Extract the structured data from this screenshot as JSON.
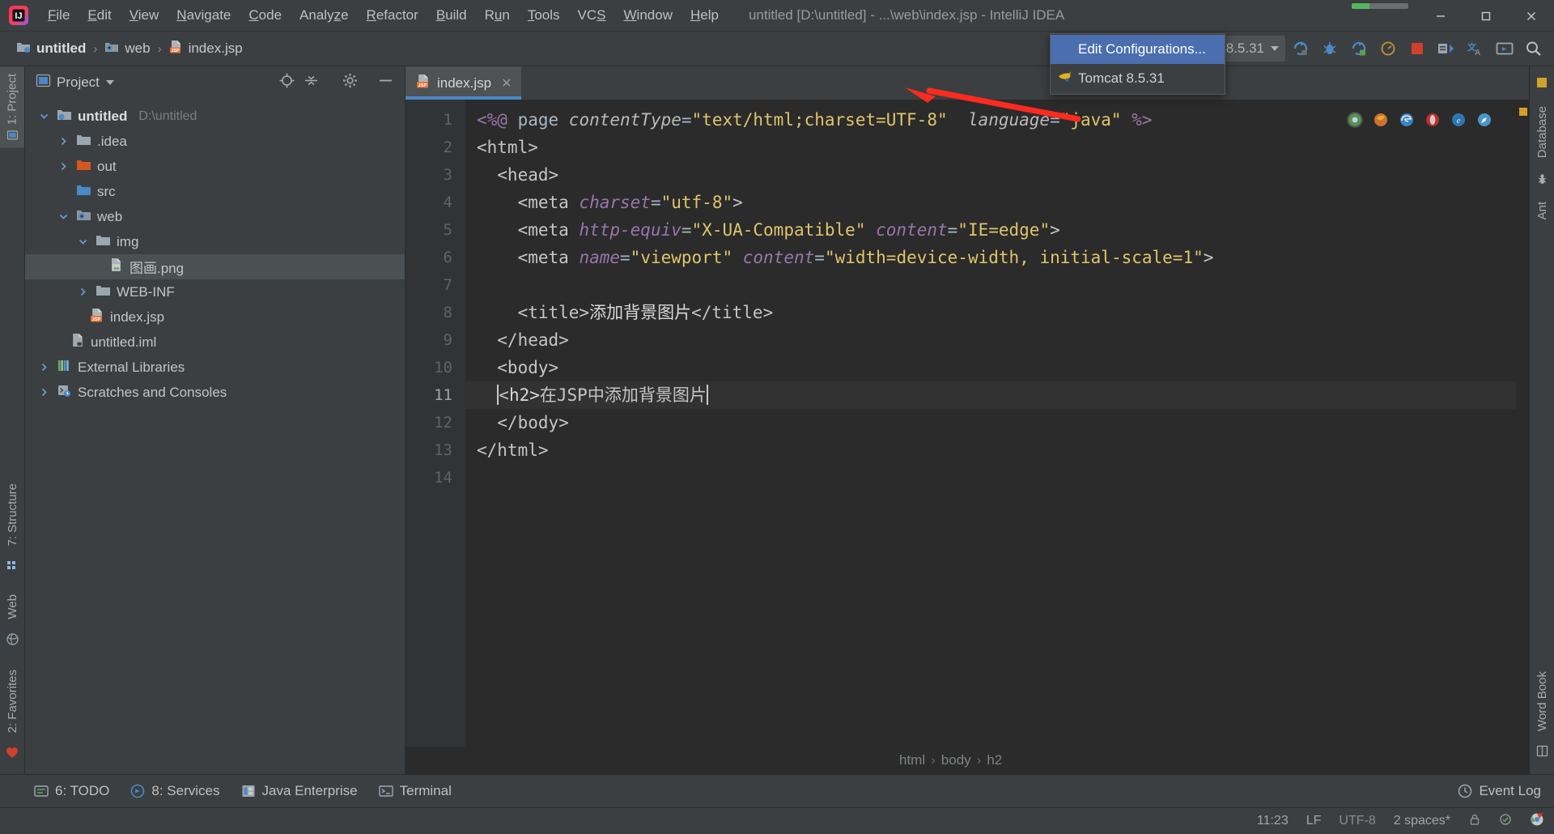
{
  "window": {
    "title": "untitled [D:\\untitled] - ...\\web\\index.jsp - IntelliJ IDEA",
    "progress_percent": 32,
    "minimize_label": "—",
    "maximize_label": "❐",
    "close_label": "✕"
  },
  "menubar": {
    "items": [
      {
        "label": "File",
        "mnemonic": "F"
      },
      {
        "label": "Edit",
        "mnemonic": "E"
      },
      {
        "label": "View",
        "mnemonic": "V"
      },
      {
        "label": "Navigate",
        "mnemonic": "N"
      },
      {
        "label": "Code",
        "mnemonic": "C"
      },
      {
        "label": "Analyze",
        "mnemonic": "z"
      },
      {
        "label": "Refactor",
        "mnemonic": "R"
      },
      {
        "label": "Build",
        "mnemonic": "B"
      },
      {
        "label": "Run",
        "mnemonic": "u"
      },
      {
        "label": "Tools",
        "mnemonic": "T"
      },
      {
        "label": "VCS",
        "mnemonic": "S"
      },
      {
        "label": "Window",
        "mnemonic": "W"
      },
      {
        "label": "Help",
        "mnemonic": "H"
      }
    ]
  },
  "navbar": {
    "breadcrumbs": [
      {
        "label": "untitled",
        "icon": "module-folder-icon"
      },
      {
        "label": "web",
        "icon": "web-folder-icon"
      },
      {
        "label": "index.jsp",
        "icon": "jsp-file-icon"
      }
    ],
    "separator": "›",
    "run_config": {
      "label": "Tomcat 8.5.31",
      "icon": "tomcat-icon",
      "caret": "chevron-down-icon"
    },
    "buttons": [
      {
        "name": "build-hammer-button",
        "icon": "hammer-icon"
      },
      {
        "name": "run-button",
        "icon": "run-icon"
      },
      {
        "name": "debug-button",
        "icon": "debug-icon"
      },
      {
        "name": "run-coverage-button",
        "icon": "coverage-icon"
      },
      {
        "name": "profile-button",
        "icon": "profile-icon"
      },
      {
        "name": "stop-button",
        "icon": "stop-icon"
      },
      {
        "name": "update-app-button",
        "icon": "update-icon"
      },
      {
        "name": "translate-button",
        "icon": "translate-icon"
      },
      {
        "name": "presentation-button",
        "icon": "screen-icon"
      },
      {
        "name": "search-everywhere-button",
        "icon": "search-icon"
      }
    ]
  },
  "run_config_popup": {
    "items": [
      {
        "label": "Edit Configurations...",
        "selected": true,
        "icon": "none"
      },
      {
        "label": "Tomcat 8.5.31",
        "selected": false,
        "icon": "tomcat-icon"
      }
    ]
  },
  "annotation": {
    "type": "red-arrow",
    "color": "#fc2b1f",
    "points_to": "Edit Configurations..."
  },
  "left_strip": {
    "top_tabs": [
      {
        "label": "1: Project",
        "selected": true,
        "icon": "project-icon"
      }
    ],
    "mid_tabs": [
      {
        "label": "7: Structure",
        "selected": false,
        "icon": "structure-icon"
      },
      {
        "label": "Web",
        "selected": false,
        "icon": "web-icon"
      },
      {
        "label": "2: Favorites",
        "selected": false,
        "icon": "favorites-icon"
      }
    ]
  },
  "right_strip": {
    "tabs": [
      {
        "label": "Database",
        "icon": "database-icon"
      },
      {
        "label": "Ant",
        "icon": "ant-icon"
      },
      {
        "label": "Word Book",
        "icon": "book-icon"
      }
    ]
  },
  "project_panel": {
    "title": "Project",
    "title_caret": "chevron-down-icon",
    "actions": [
      {
        "name": "scroll-from-source-button",
        "icon": "target-icon"
      },
      {
        "name": "collapse-all-button",
        "icon": "collapse-all-icon"
      },
      {
        "name": "settings-button",
        "icon": "gear-icon"
      },
      {
        "name": "hide-button",
        "icon": "minus-icon"
      }
    ],
    "tree": [
      {
        "label": "untitled",
        "path": "D:\\untitled",
        "indent": 0,
        "twisty": "expanded",
        "icon": "module-folder-icon",
        "bold": true,
        "selected": false
      },
      {
        "label": ".idea",
        "path": "",
        "indent": 1,
        "twisty": "collapsed",
        "icon": "folder-icon",
        "bold": false,
        "selected": false
      },
      {
        "label": "out",
        "path": "",
        "indent": 1,
        "twisty": "collapsed",
        "icon": "folder-orange-icon",
        "bold": false,
        "selected": false
      },
      {
        "label": "src",
        "path": "",
        "indent": 1,
        "twisty": "none",
        "icon": "folder-blue-icon",
        "bold": false,
        "selected": false
      },
      {
        "label": "web",
        "path": "",
        "indent": 1,
        "twisty": "expanded",
        "icon": "web-folder-icon",
        "bold": false,
        "selected": false
      },
      {
        "label": "img",
        "path": "",
        "indent": 2,
        "twisty": "expanded",
        "icon": "folder-icon",
        "bold": false,
        "selected": false
      },
      {
        "label": "图画.png",
        "path": "",
        "indent": 3,
        "twisty": "none",
        "icon": "image-file-icon",
        "bold": false,
        "selected": true
      },
      {
        "label": "WEB-INF",
        "path": "",
        "indent": 2,
        "twisty": "collapsed",
        "icon": "folder-icon",
        "bold": false,
        "selected": false
      },
      {
        "label": "index.jsp",
        "path": "",
        "indent": 2,
        "twisty": "none",
        "icon": "jsp-file-icon",
        "bold": false,
        "selected": false
      },
      {
        "label": "untitled.iml",
        "path": "",
        "indent": 1,
        "twisty": "none",
        "icon": "iml-file-icon",
        "bold": false,
        "selected": false
      },
      {
        "label": "External Libraries",
        "path": "",
        "indent": 0,
        "twisty": "collapsed",
        "icon": "libraries-icon",
        "bold": false,
        "selected": false
      },
      {
        "label": "Scratches and Consoles",
        "path": "",
        "indent": 0,
        "twisty": "collapsed",
        "icon": "scratches-icon",
        "bold": false,
        "selected": false
      }
    ]
  },
  "editor": {
    "tabs": [
      {
        "label": "index.jsp",
        "icon": "jsp-file-icon",
        "close": "✕",
        "active": true
      }
    ],
    "current_line": 11,
    "lines": [
      {
        "n": 1,
        "segments": [
          {
            "t": "<%@ ",
            "c": "dir"
          },
          {
            "t": "page ",
            "c": "txt"
          },
          {
            "t": "contentType",
            "c": "attr"
          },
          {
            "t": "=",
            "c": "punc"
          },
          {
            "t": "\"text/html;charset=UTF-8\"",
            "c": "attrv"
          },
          {
            "t": "  ",
            "c": "txt"
          },
          {
            "t": "language",
            "c": "attr"
          },
          {
            "t": "=",
            "c": "punc"
          },
          {
            "t": "\"java\"",
            "c": "attrv"
          },
          {
            "t": " %>",
            "c": "dir"
          }
        ]
      },
      {
        "n": 2,
        "segments": [
          {
            "t": "<html>",
            "c": "tag"
          }
        ]
      },
      {
        "n": 3,
        "segments": [
          {
            "t": "  <head>",
            "c": "tag"
          }
        ]
      },
      {
        "n": 4,
        "segments": [
          {
            "t": "    <meta ",
            "c": "tag"
          },
          {
            "t": "charset",
            "c": "attr"
          },
          {
            "t": "=",
            "c": "punc"
          },
          {
            "t": "\"utf-8\"",
            "c": "attrv"
          },
          {
            "t": ">",
            "c": "tag"
          }
        ]
      },
      {
        "n": 5,
        "segments": [
          {
            "t": "    <meta ",
            "c": "tag"
          },
          {
            "t": "http-equiv",
            "c": "attr"
          },
          {
            "t": "=",
            "c": "punc"
          },
          {
            "t": "\"X-UA-Compatible\"",
            "c": "attrv"
          },
          {
            "t": " ",
            "c": "txt"
          },
          {
            "t": "content",
            "c": "attr"
          },
          {
            "t": "=",
            "c": "punc"
          },
          {
            "t": "\"IE=edge\"",
            "c": "attrv"
          },
          {
            "t": ">",
            "c": "tag"
          }
        ]
      },
      {
        "n": 6,
        "segments": [
          {
            "t": "    <meta ",
            "c": "tag"
          },
          {
            "t": "name",
            "c": "attr"
          },
          {
            "t": "=",
            "c": "punc"
          },
          {
            "t": "\"viewport\"",
            "c": "attrv"
          },
          {
            "t": " ",
            "c": "txt"
          },
          {
            "t": "content",
            "c": "attr"
          },
          {
            "t": "=",
            "c": "punc"
          },
          {
            "t": "\"width=device-width, initial-scale=1\"",
            "c": "attrv"
          },
          {
            "t": ">",
            "c": "tag"
          }
        ]
      },
      {
        "n": 7,
        "segments": []
      },
      {
        "n": 8,
        "segments": [
          {
            "t": "    <title>",
            "c": "tag"
          },
          {
            "t": "添加背景图片",
            "c": "txt"
          },
          {
            "t": "</title>",
            "c": "tag"
          }
        ]
      },
      {
        "n": 9,
        "segments": [
          {
            "t": "  </head>",
            "c": "tag"
          }
        ]
      },
      {
        "n": 10,
        "segments": [
          {
            "t": "  <body>",
            "c": "tag"
          }
        ]
      },
      {
        "n": 11,
        "segments": [
          {
            "t": "  ",
            "c": "txt"
          },
          {
            "t": "<",
            "c": "caret"
          },
          {
            "t": "h2>",
            "c": "tag"
          },
          {
            "t": "在JSP中添加背景图片",
            "c": "txt"
          },
          {
            "t": "</h2",
            "c": "tag"
          },
          {
            "t": ">",
            "c": "caret"
          }
        ]
      },
      {
        "n": 12,
        "segments": [
          {
            "t": "  </body>",
            "c": "tag"
          }
        ]
      },
      {
        "n": 13,
        "segments": [
          {
            "t": "</html>",
            "c": "tag"
          }
        ]
      },
      {
        "n": 14,
        "segments": []
      }
    ],
    "breadcrumb": [
      "html",
      "body",
      "h2"
    ],
    "breadcrumb_sep": "›",
    "browser_icons": [
      "chrome-icon",
      "firefox-alt-icon",
      "edge-icon",
      "opera-icon",
      "ie-icon",
      "safari-icon"
    ]
  },
  "bottom_bar": {
    "tools": [
      {
        "label": "6: TODO",
        "icon": "todo-icon",
        "mnemonic": "6"
      },
      {
        "label": "8: Services",
        "icon": "services-icon",
        "mnemonic": "8"
      },
      {
        "label": "Java Enterprise",
        "icon": "java-ee-icon",
        "mnemonic": ""
      },
      {
        "label": "Terminal",
        "icon": "terminal-icon",
        "mnemonic": ""
      }
    ],
    "event_log": {
      "label": "Event Log",
      "icon": "event-log-icon"
    }
  },
  "status_bar": {
    "time": "11:23",
    "line_separator": "LF",
    "encoding": "UTF-8",
    "indent": "2 spaces*",
    "icons": [
      "lock-icon",
      "inspection-icon",
      "chrome-icon"
    ]
  },
  "colors": {
    "accent": "#4b6eaf",
    "panel": "#3c3f41",
    "editor_bg": "#2b2b2b",
    "tab_active": "#4e5254",
    "annotation_red": "#fc2b1f",
    "tag": "#e8bf6a",
    "string": "#6a8759",
    "directive": "#9876aa"
  }
}
